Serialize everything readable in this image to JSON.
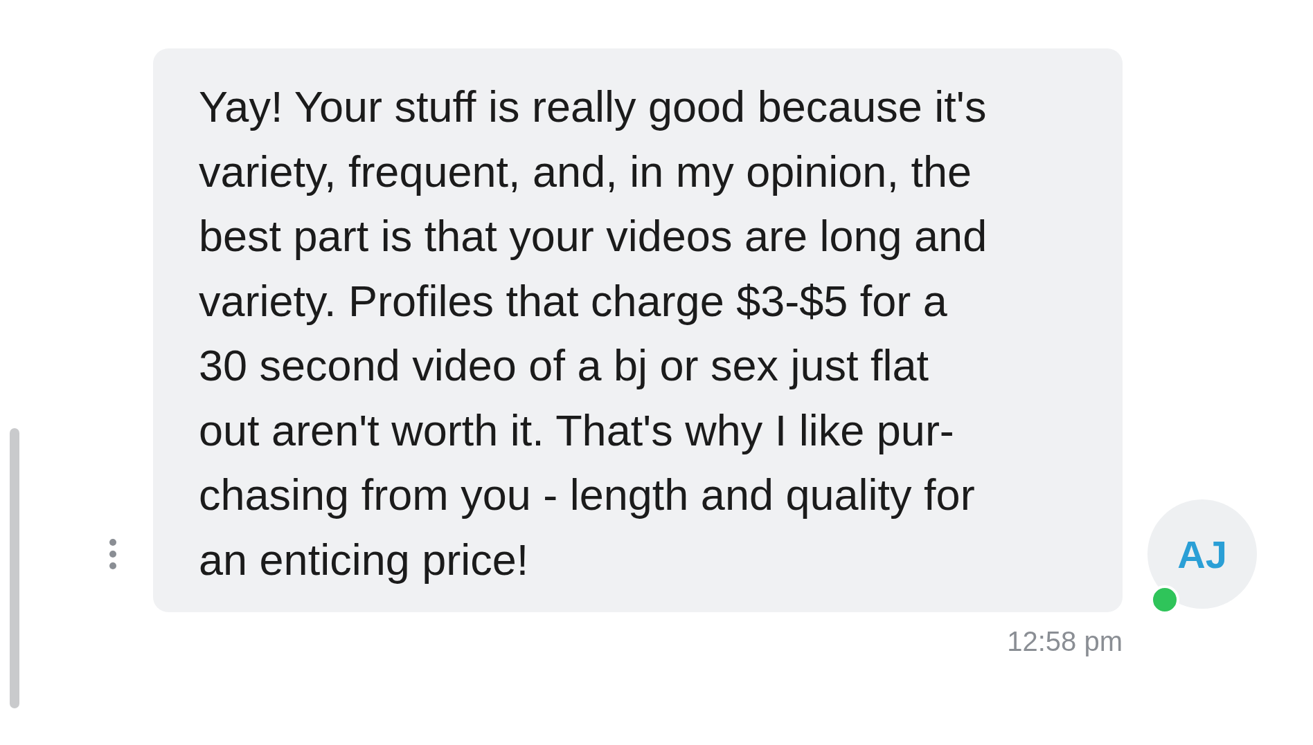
{
  "message": {
    "avatar_initials": "AJ",
    "online": true,
    "text": "Yay! Your stuff is really good because it's\nvariety, frequent, and, in my opinion, the\nbest part is that your videos are long and\nvariety. Profiles that charge $3-$5 for a\n30 second video of a bj or sex just flat\nout aren't worth it. That's why I like pur-\nchasing from you - length and quality for\nan enticing price!",
    "time": "12:58 pm"
  }
}
